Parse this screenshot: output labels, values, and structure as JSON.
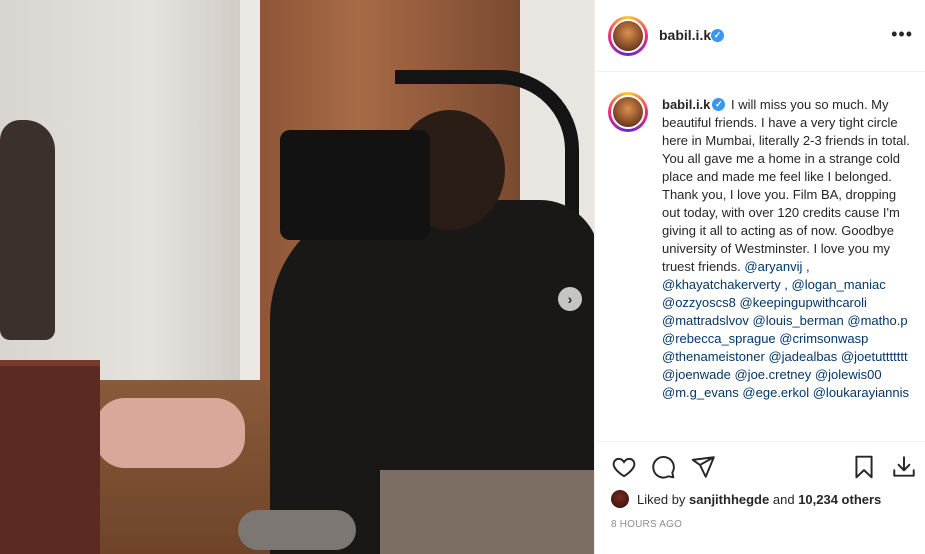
{
  "post": {
    "username": "babil.i.k",
    "verified_mark": "✓",
    "more_glyph": "•••",
    "caption": {
      "username": "babil.i.k",
      "text": "I will miss you so much. My beautiful friends. I have a very tight circle here in Mumbai, literally 2-3 friends in total. You all gave me a home in a strange cold place and made me feel like I belonged. Thank you, I love you. Film BA, dropping out today, with over 120 credits cause I'm giving it all to acting as of now. Goodbye university of Westminster. I love you my truest friends.",
      "mentions": [
        "@aryanvij ,",
        "@khayatchakerverty ,",
        "@logan_maniac",
        "@ozzyoscs8",
        "@keepingupwithcaroli",
        "@mattradslvov",
        "@louis_berman",
        "@matho.p",
        "@rebecca_sprague",
        "@crimsonwasp",
        "@thenameistoner",
        "@jadealbas",
        "@joetuttttttt",
        "@joenwade",
        "@joe.cretney",
        "@jolewis00",
        "@m.g_evans",
        "@ege.erkol",
        "@loukarayiannis"
      ]
    },
    "likes": {
      "prefix": "Liked by",
      "user": "sanjithhegde",
      "middle": "and",
      "count": "10,234 others"
    },
    "timestamp": "8 HOURS AGO",
    "carousel_next_glyph": "›",
    "icons": {
      "like": "heart-icon",
      "comment": "comment-icon",
      "share": "share-icon",
      "save": "bookmark-icon",
      "download": "download-icon"
    },
    "colors": {
      "text": "#262626",
      "mention": "#00376b",
      "verified": "#3897f0",
      "muted": "#8e8e8e"
    }
  }
}
